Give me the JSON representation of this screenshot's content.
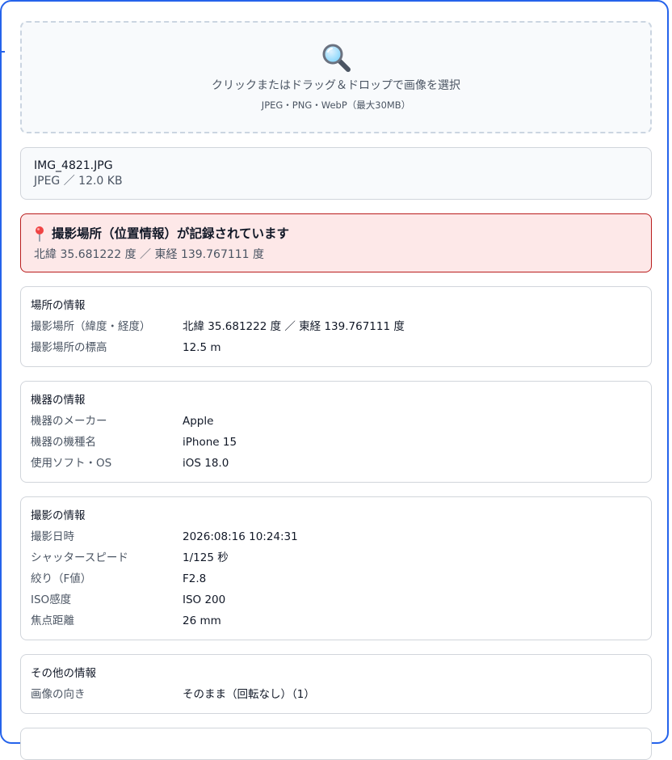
{
  "dropzone": {
    "icon": "magnifier-icon",
    "text": "クリックまたはドラッグ＆ドロップで画像を選択",
    "subtext": "JPEG・PNG・WebP（最大30MB）"
  },
  "file": {
    "name": "IMG_4821.JPG",
    "meta": "JPEG ／ 12.0 KB"
  },
  "alert": {
    "icon": "map-pin-icon",
    "title": "撮影場所（位置情報）が記録されています",
    "coords": "北緯 35.681222 度 ／ 東経 139.767111 度",
    "background": "#fde8e8",
    "border": "#b91c1c"
  },
  "sections": [
    {
      "title": "場所の情報",
      "rows": [
        {
          "label": "撮影場所（緯度・経度）",
          "value": "北緯 35.681222 度 ／ 東経 139.767111 度"
        },
        {
          "label": "撮影場所の標高",
          "value": "12.5 m"
        }
      ]
    },
    {
      "title": "機器の情報",
      "rows": [
        {
          "label": "機器のメーカー",
          "value": "Apple"
        },
        {
          "label": "機器の機種名",
          "value": "iPhone 15"
        },
        {
          "label": "使用ソフト・OS",
          "value": "iOS 18.0"
        }
      ]
    },
    {
      "title": "撮影の情報",
      "rows": [
        {
          "label": "撮影日時",
          "value": "2026:08:16 10:24:31"
        },
        {
          "label": "シャッタースピード",
          "value": "1/125 秒"
        },
        {
          "label": "絞り（F値）",
          "value": "F2.8"
        },
        {
          "label": "ISO感度",
          "value": "ISO 200"
        },
        {
          "label": "焦点距離",
          "value": "26 mm"
        }
      ]
    },
    {
      "title": "その他の情報",
      "rows": [
        {
          "label": "画像の向き",
          "value": "そのまま（回転なし）（1）"
        }
      ]
    }
  ],
  "accent_color": "#2563eb"
}
